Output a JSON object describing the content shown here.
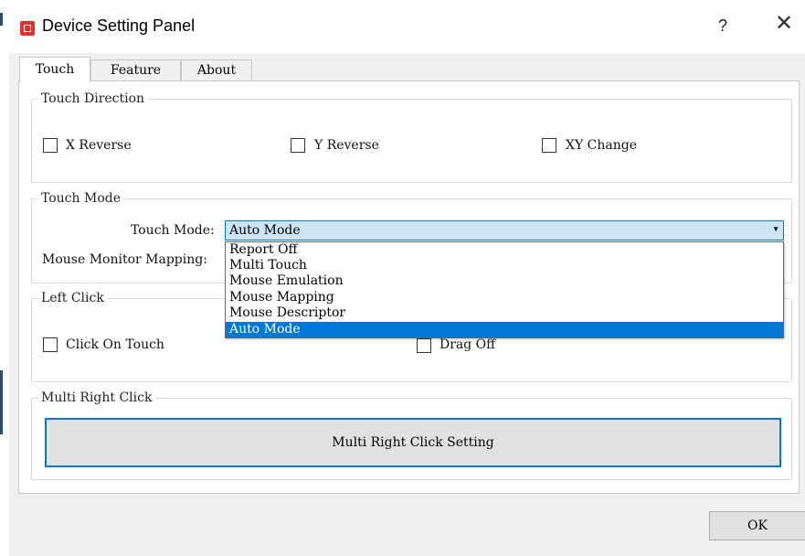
{
  "window": {
    "title": "Device Setting Panel",
    "help": "?",
    "close": "✕"
  },
  "tabs": [
    {
      "label": "Touch",
      "active": true
    },
    {
      "label": "Feature",
      "active": false
    },
    {
      "label": "About",
      "active": false
    }
  ],
  "touch_direction": {
    "title": "Touch Direction",
    "options": [
      {
        "label": "X Reverse",
        "checked": false
      },
      {
        "label": "Y Reverse",
        "checked": false
      },
      {
        "label": "XY Change",
        "checked": false
      }
    ]
  },
  "touch_mode": {
    "title": "Touch Mode",
    "mode_label": "Touch Mode:",
    "mode_value": "Auto Mode",
    "mapping_label": "Mouse Monitor Mapping:",
    "dropdown_options": [
      "Report Off",
      "Multi Touch",
      "Mouse Emulation",
      "Mouse Mapping",
      "Mouse Descriptor",
      "Auto Mode"
    ],
    "selected_index": 5
  },
  "left_click": {
    "title": "Left Click",
    "click_on_touch": {
      "label": "Click On Touch",
      "checked": false
    },
    "drag_off": {
      "label": "Drag Off",
      "checked": false
    }
  },
  "multi_right_click": {
    "title": "Multi Right Click",
    "button_label": "Multi Right Click Setting"
  },
  "ok_label": "OK",
  "colors": {
    "accent": "#0078d7",
    "selection": "#0078d7",
    "combo_bg": "#cce4f7",
    "dialog_bg": "#f0f0f0"
  }
}
